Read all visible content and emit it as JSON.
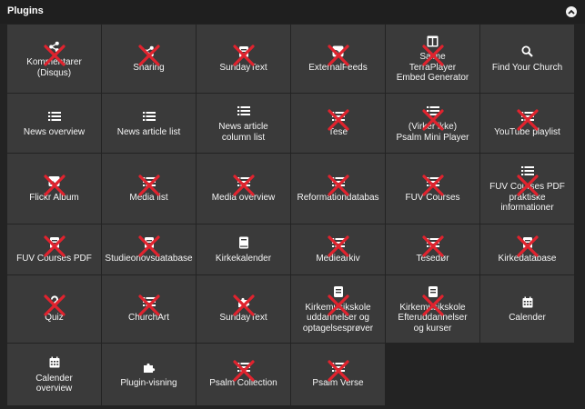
{
  "panel": {
    "title": "Plugins"
  },
  "colors": {
    "background": "#232323",
    "tile": "#3a3a3a",
    "disabled_mark": "#e0232e"
  },
  "tiles": [
    {
      "label": "Kommentarer\n(Disqus)",
      "icon": "share-icon",
      "disabled": true
    },
    {
      "label": "Sharing",
      "icon": "share-icon",
      "disabled": true
    },
    {
      "label": "SundayText",
      "icon": "document-icon",
      "disabled": true
    },
    {
      "label": "ExternalFeeds",
      "icon": "rss-icon",
      "disabled": true
    },
    {
      "label": "Salme\nTerraPlayer\nEmbed Generator",
      "icon": "columns-icon",
      "disabled": true
    },
    {
      "label": "Find Your Church",
      "icon": "search-icon",
      "disabled": false
    },
    {
      "label": "News overview",
      "icon": "list-icon",
      "disabled": false
    },
    {
      "label": "News article list",
      "icon": "list-icon",
      "disabled": false
    },
    {
      "label": "News article\ncolumn list",
      "icon": "list-icon",
      "disabled": false
    },
    {
      "label": "Tese",
      "icon": "list-icon",
      "disabled": true
    },
    {
      "label": "(Virker ikke)\nPsalm Mini Player",
      "icon": "list-icon",
      "disabled": true
    },
    {
      "label": "YouTube playlist",
      "icon": "list-icon",
      "disabled": true
    },
    {
      "label": "Flickr Album",
      "icon": "image-icon",
      "disabled": true
    },
    {
      "label": "Media list",
      "icon": "list-icon",
      "disabled": true
    },
    {
      "label": "Media overview",
      "icon": "list-icon",
      "disabled": true
    },
    {
      "label": "Reformationdatabas",
      "icon": "list-icon",
      "disabled": true
    },
    {
      "label": "FUV Courses",
      "icon": "list-icon",
      "disabled": true
    },
    {
      "label": "FUV Courses PDF\npraktiske\ninformationer",
      "icon": "list-icon",
      "disabled": true
    },
    {
      "label": "FUV Courses PDF",
      "icon": "document-icon",
      "disabled": true
    },
    {
      "label": "Studieorlovsdatabase",
      "icon": "document-icon",
      "disabled": true
    },
    {
      "label": "Kirkekalender",
      "icon": "book-icon",
      "disabled": false
    },
    {
      "label": "Mediearkiv",
      "icon": "list-icon",
      "disabled": true
    },
    {
      "label": "Tesedør",
      "icon": "list-icon",
      "disabled": true
    },
    {
      "label": "Kirkedatabase",
      "icon": "document-icon",
      "disabled": true
    },
    {
      "label": "Quiz",
      "icon": "question-icon",
      "disabled": true
    },
    {
      "label": "ChurchArt",
      "icon": "list-icon",
      "disabled": true
    },
    {
      "label": "SundayText",
      "icon": "puzzle-icon",
      "disabled": true
    },
    {
      "label": "Kirkemusikskole\nuddannelser og\noptagelsesprøver",
      "icon": "document-icon",
      "disabled": true
    },
    {
      "label": "Kirkemusikskole\nEfteruddannelser\nog kurser",
      "icon": "document-icon",
      "disabled": true
    },
    {
      "label": "Calender",
      "icon": "calendar-icon",
      "disabled": false
    },
    {
      "label": "Calender\noverview",
      "icon": "calendar-icon",
      "disabled": false
    },
    {
      "label": "Plugin-visning",
      "icon": "puzzle-icon",
      "disabled": false
    },
    {
      "label": "Psalm Collection",
      "icon": "list-icon",
      "disabled": true
    },
    {
      "label": "Psalm Verse",
      "icon": "list-icon",
      "disabled": true
    }
  ]
}
